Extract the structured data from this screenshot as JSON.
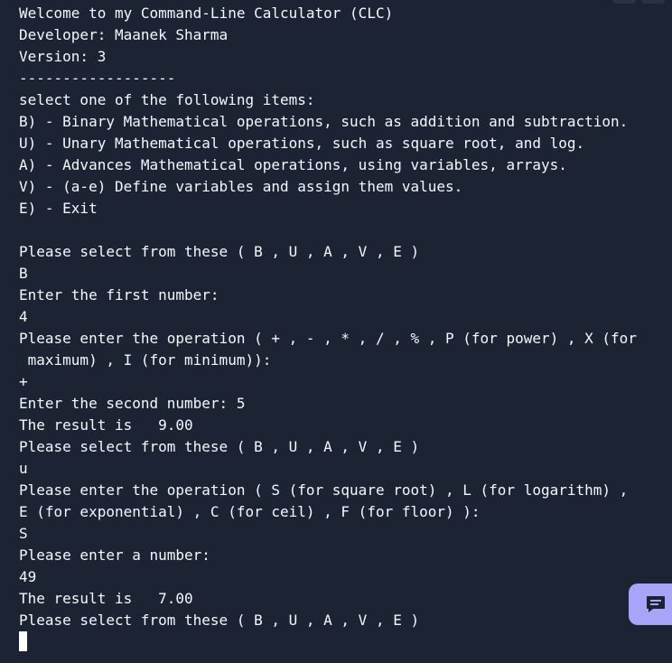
{
  "terminal": {
    "lines": [
      "Welcome to my Command-Line Calculator (CLC)",
      "Developer: Maanek Sharma",
      "Version: 3",
      "------------------",
      "select one of the following items:",
      "B) - Binary Mathematical operations, such as addition and subtraction.",
      "U) - Unary Mathematical operations, such as square root, and log.",
      "A) - Advances Mathematical operations, using variables, arrays.",
      "V) - (a-e) Define variables and assign them values.",
      "E) - Exit",
      "",
      "Please select from these ( B , U , A , V , E )",
      "B",
      "Enter the first number:",
      "4",
      "Please enter the operation ( + , - , * , / , % , P (for power) , X (for",
      " maximum) , I (for minimum)):",
      "+",
      "Enter the second number: 5",
      "The result is   9.00",
      "Please select from these ( B , U , A , V , E )",
      "u",
      "Please enter the operation ( S (for square root) , L (for logarithm) ,",
      "E (for exponential) , C (for ceil) , F (for floor) ):",
      "S",
      "Please enter a number:",
      "49",
      "The result is   7.00",
      "Please select from these ( B , U , A , V , E )"
    ]
  },
  "colors": {
    "background": "#1c2333",
    "text": "#f5f9fc",
    "chat_button": "#a8a4f7"
  },
  "icons": {
    "chat": "chat-bubble-icon"
  }
}
